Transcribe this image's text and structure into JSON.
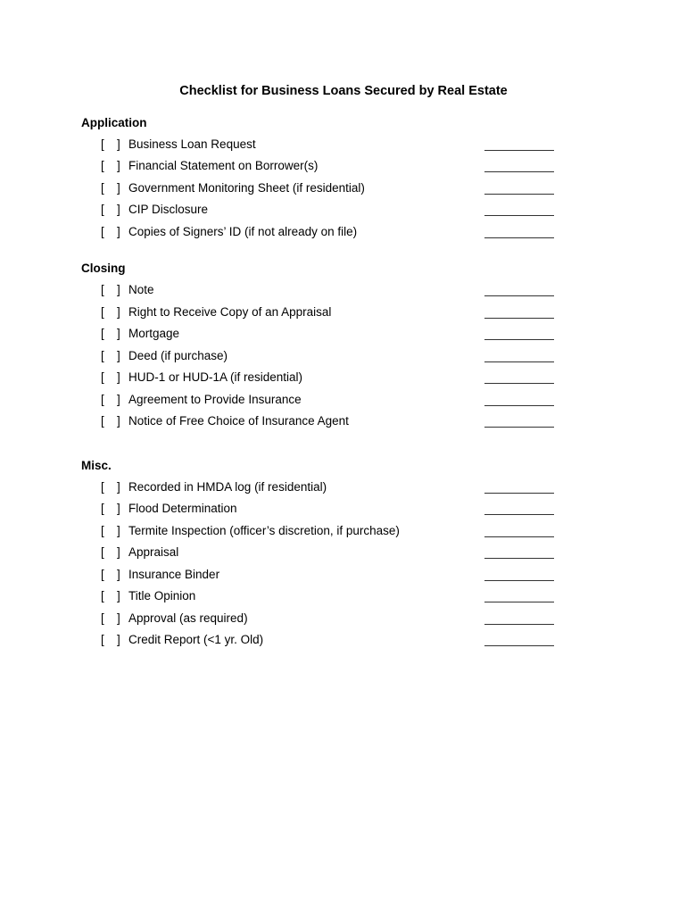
{
  "document": {
    "title": "Checklist for Business Loans Secured by Real Estate",
    "checkbox_open": "[",
    "checkbox_close": "]",
    "sections": [
      {
        "heading": "Application",
        "items": [
          {
            "label": "Business Loan Request",
            "checked": false,
            "initials": ""
          },
          {
            "label": "Financial Statement on Borrower(s)",
            "checked": false,
            "initials": ""
          },
          {
            "label": "Government Monitoring Sheet (if residential)",
            "checked": false,
            "initials": ""
          },
          {
            "label": "CIP Disclosure",
            "checked": false,
            "initials": ""
          },
          {
            "label": "Copies of Signers’ ID (if not already on file)",
            "checked": false,
            "initials": ""
          }
        ]
      },
      {
        "heading": "Closing",
        "items": [
          {
            "label": "Note",
            "checked": false,
            "initials": ""
          },
          {
            "label": "Right to Receive Copy of an Appraisal",
            "checked": false,
            "initials": ""
          },
          {
            "label": "Mortgage",
            "checked": false,
            "initials": ""
          },
          {
            "label": "Deed (if purchase)",
            "checked": false,
            "initials": ""
          },
          {
            "label": "HUD-1 or HUD-1A (if residential)",
            "checked": false,
            "initials": ""
          },
          {
            "label": "Agreement to Provide Insurance",
            "checked": false,
            "initials": ""
          },
          {
            "label": "Notice of Free Choice of Insurance Agent",
            "checked": false,
            "initials": ""
          }
        ]
      },
      {
        "heading": "Misc.",
        "items": [
          {
            "label": "Recorded in HMDA log (if residential)",
            "checked": false,
            "initials": ""
          },
          {
            "label": "Flood Determination",
            "checked": false,
            "initials": ""
          },
          {
            "label": "Termite Inspection (officer’s discretion, if purchase)",
            "checked": false,
            "initials": ""
          },
          {
            "label": "Appraisal",
            "checked": false,
            "initials": ""
          },
          {
            "label": "Insurance Binder",
            "checked": false,
            "initials": ""
          },
          {
            "label": "Title Opinion",
            "checked": false,
            "initials": ""
          },
          {
            "label": "Approval (as required)",
            "checked": false,
            "initials": ""
          },
          {
            "label": "Credit Report (<1 yr. Old)",
            "checked": false,
            "initials": ""
          }
        ]
      }
    ]
  }
}
